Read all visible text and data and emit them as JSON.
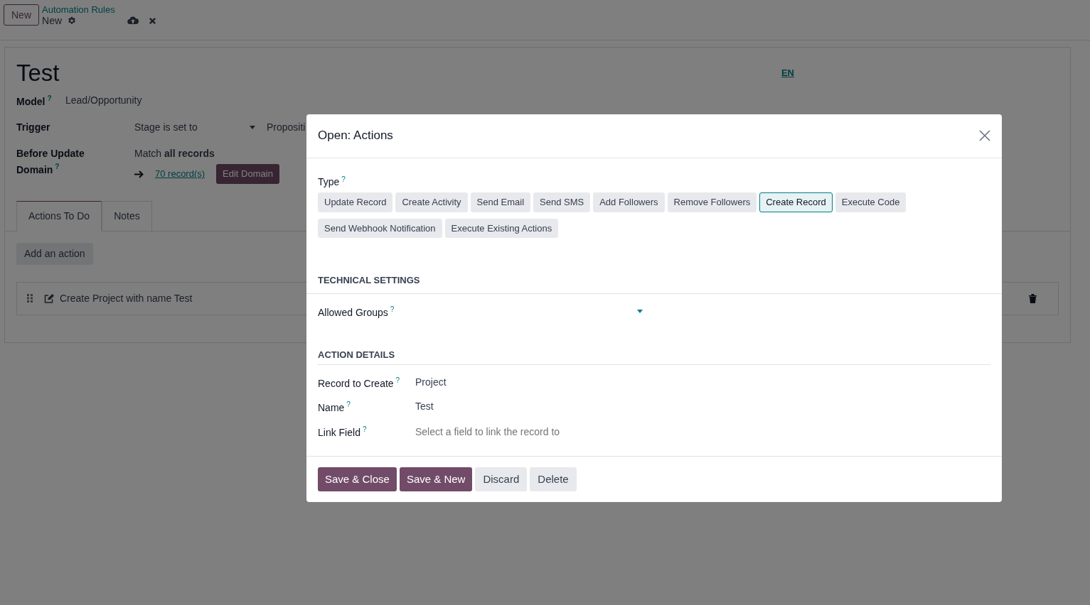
{
  "control_panel": {
    "new_button": "New",
    "breadcrumb": "Automation Rules",
    "record": "New"
  },
  "form": {
    "title": "Test",
    "language": "EN",
    "model": {
      "label": "Model",
      "help": "?",
      "value": "Lead/Opportunity"
    },
    "trigger": {
      "label": "Trigger",
      "value": "Stage is set to",
      "stage": "Propositi"
    },
    "domain": {
      "label_line1": "Before Update",
      "label_line2": "Domain",
      "help": "?",
      "summary": "Match **all records**",
      "records_link": "70 record(s)",
      "edit_button": "Edit Domain"
    },
    "tabs": [
      {
        "label": "Actions To Do",
        "selected": true
      },
      {
        "label": "Notes",
        "selected": false
      }
    ],
    "add_button": "Add an action",
    "actions": [
      {
        "text": "Create Project with name Test"
      }
    ]
  },
  "dialog": {
    "title": "Open: Actions",
    "type_label": "Type",
    "type_help": "?",
    "types": [
      {
        "label": "Update Record",
        "selected": false
      },
      {
        "label": "Create Activity",
        "selected": false
      },
      {
        "label": "Send Email",
        "selected": false
      },
      {
        "label": "Send SMS",
        "selected": false
      },
      {
        "label": "Add Followers",
        "selected": false
      },
      {
        "label": "Remove Followers",
        "selected": false
      },
      {
        "label": "Create Record",
        "selected": true
      },
      {
        "label": "Execute Code",
        "selected": false
      },
      {
        "label": "Send Webhook Notification",
        "selected": false
      },
      {
        "label": "Execute Existing Actions",
        "selected": false
      }
    ],
    "technical_heading": "TECHNICAL SETTINGS",
    "allowed_groups": {
      "label": "Allowed Groups",
      "help": "?"
    },
    "details_heading": "ACTION DETAILS",
    "details": [
      {
        "label": "Record to Create",
        "help": "?",
        "value": "Project"
      },
      {
        "label": "Name",
        "help": "?",
        "value": "Test"
      },
      {
        "label": "Link Field",
        "help": "?",
        "placeholder": "Select a field to link the record to"
      }
    ],
    "footer_buttons": [
      {
        "label": "Save & Close",
        "kind": "primary"
      },
      {
        "label": "Save & New",
        "kind": "primary"
      },
      {
        "label": "Discard",
        "kind": "secondary"
      },
      {
        "label": "Delete",
        "kind": "secondary"
      }
    ]
  }
}
